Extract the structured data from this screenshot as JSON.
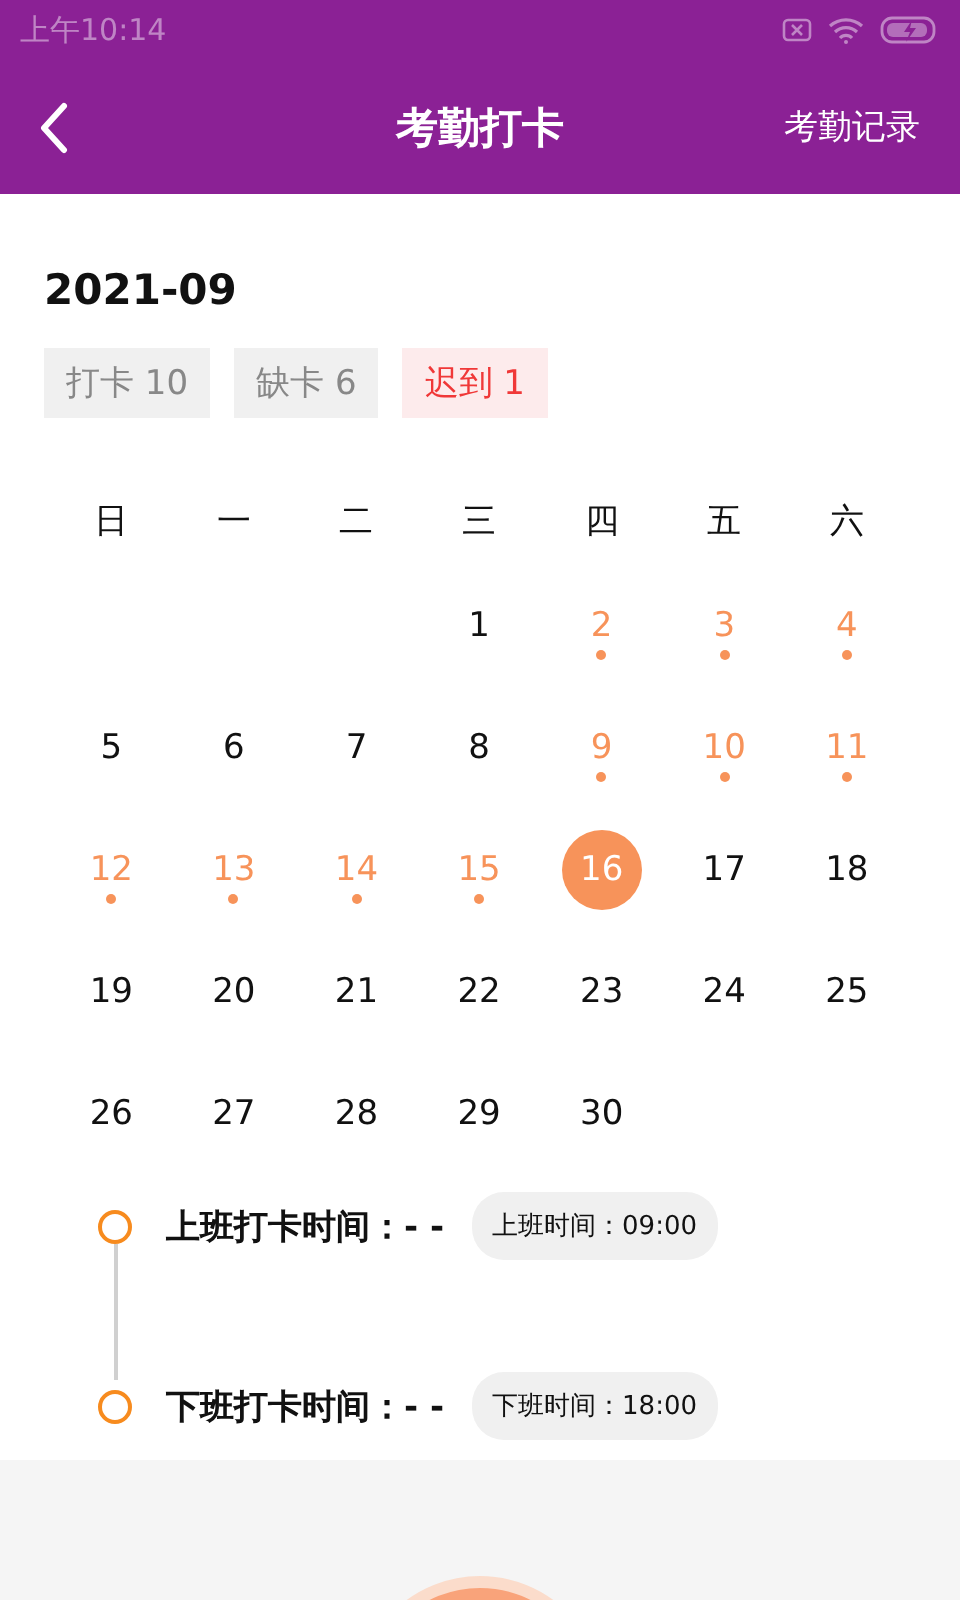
{
  "status_bar": {
    "time": "上午10:14"
  },
  "header": {
    "title": "考勤打卡",
    "action": "考勤记录"
  },
  "month": "2021-09",
  "stats": [
    {
      "label": "打卡 10",
      "kind": "neutral"
    },
    {
      "label": "缺卡 6",
      "kind": "neutral"
    },
    {
      "label": "迟到 1",
      "kind": "alert"
    }
  ],
  "weekdays": [
    "日",
    "一",
    "二",
    "三",
    "四",
    "五",
    "六"
  ],
  "weeks": [
    [
      {
        "day": "1",
        "marked": false,
        "selected": false
      },
      {
        "day": "2",
        "marked": true,
        "selected": false
      },
      {
        "day": "3",
        "marked": true,
        "selected": false
      },
      {
        "day": "4",
        "marked": true,
        "selected": false
      }
    ],
    [
      {
        "day": "5",
        "marked": false,
        "selected": false
      },
      {
        "day": "6",
        "marked": false,
        "selected": false
      },
      {
        "day": "7",
        "marked": false,
        "selected": false
      },
      {
        "day": "8",
        "marked": false,
        "selected": false
      },
      {
        "day": "9",
        "marked": true,
        "selected": false
      },
      {
        "day": "10",
        "marked": true,
        "selected": false
      },
      {
        "day": "11",
        "marked": true,
        "selected": false
      }
    ],
    [
      {
        "day": "12",
        "marked": true,
        "selected": false
      },
      {
        "day": "13",
        "marked": true,
        "selected": false
      },
      {
        "day": "14",
        "marked": true,
        "selected": false
      },
      {
        "day": "15",
        "marked": true,
        "selected": false
      },
      {
        "day": "16",
        "marked": false,
        "selected": true
      },
      {
        "day": "17",
        "marked": false,
        "selected": false
      },
      {
        "day": "18",
        "marked": false,
        "selected": false
      }
    ],
    [
      {
        "day": "19",
        "marked": false,
        "selected": false
      },
      {
        "day": "20",
        "marked": false,
        "selected": false
      },
      {
        "day": "21",
        "marked": false,
        "selected": false
      },
      {
        "day": "22",
        "marked": false,
        "selected": false
      },
      {
        "day": "23",
        "marked": false,
        "selected": false
      },
      {
        "day": "24",
        "marked": false,
        "selected": false
      },
      {
        "day": "25",
        "marked": false,
        "selected": false
      }
    ],
    [
      {
        "day": "26",
        "marked": false,
        "selected": false
      },
      {
        "day": "27",
        "marked": false,
        "selected": false
      },
      {
        "day": "28",
        "marked": false,
        "selected": false
      },
      {
        "day": "29",
        "marked": false,
        "selected": false
      },
      {
        "day": "30",
        "marked": false,
        "selected": false
      }
    ]
  ],
  "timeline": [
    {
      "label": "上班打卡时间：",
      "value": "- -",
      "schedule": "上班时间：09:00"
    },
    {
      "label": "下班打卡时间：",
      "value": "- -",
      "schedule": "下班时间：18:00"
    }
  ]
}
